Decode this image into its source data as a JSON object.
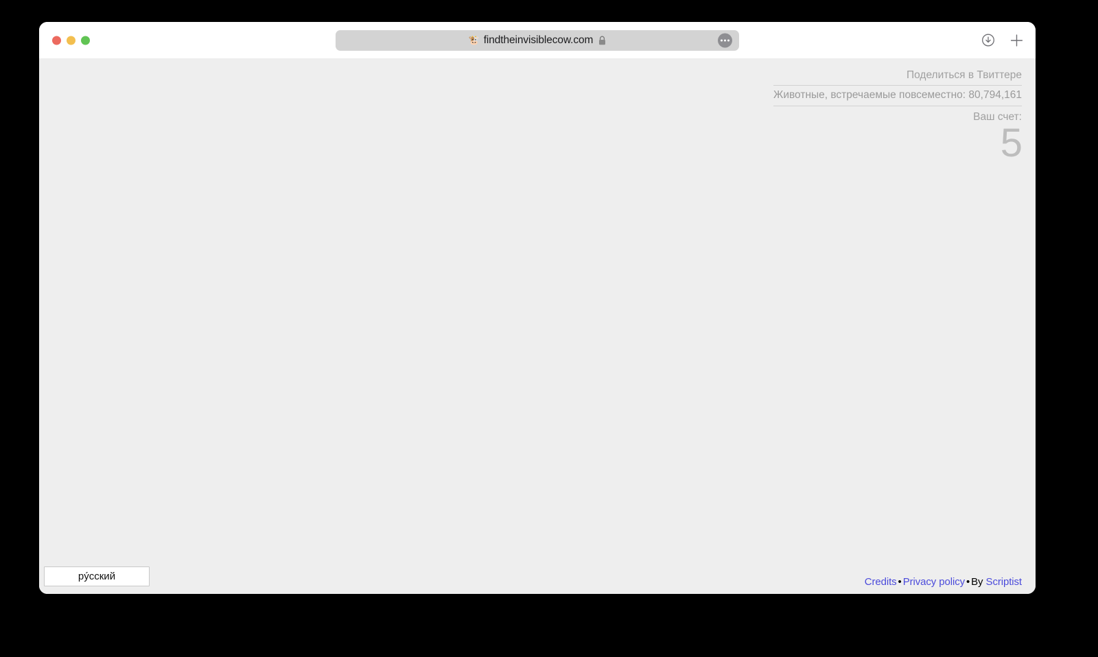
{
  "browser": {
    "traffic_lights": {
      "close_label": "close",
      "minimize_label": "minimize",
      "maximize_label": "maximize",
      "close_color": "#ec6a5f",
      "minimize_color": "#f3bf4f",
      "maximize_color": "#61c454"
    },
    "address_bar": {
      "url": "findtheinvisiblecow.com",
      "favicon": "cow-emoji",
      "favicon_glyph": "🐮",
      "secure_icon": "lock-icon",
      "more_button": "more-options-icon"
    },
    "toolbar_icons": [
      {
        "name": "downloads-icon",
        "label": "Downloads"
      },
      {
        "name": "new-tab-icon",
        "label": "New Tab"
      }
    ]
  },
  "page": {
    "background_color": "#eeeeee",
    "share_link": "Поделиться в Твиттере",
    "counter_text": "Животные, встречаемые повсеместно: 80,794,161",
    "counter_value": "80,794,161",
    "score_label": "Ваш счет:",
    "score_value": "5",
    "language": {
      "selected": "рýсский"
    },
    "footer": {
      "credits": "Credits",
      "privacy": "Privacy policy",
      "separator": "•",
      "by_text": "By",
      "author": "Scriptist",
      "link_color": "#4b4bdb"
    }
  }
}
